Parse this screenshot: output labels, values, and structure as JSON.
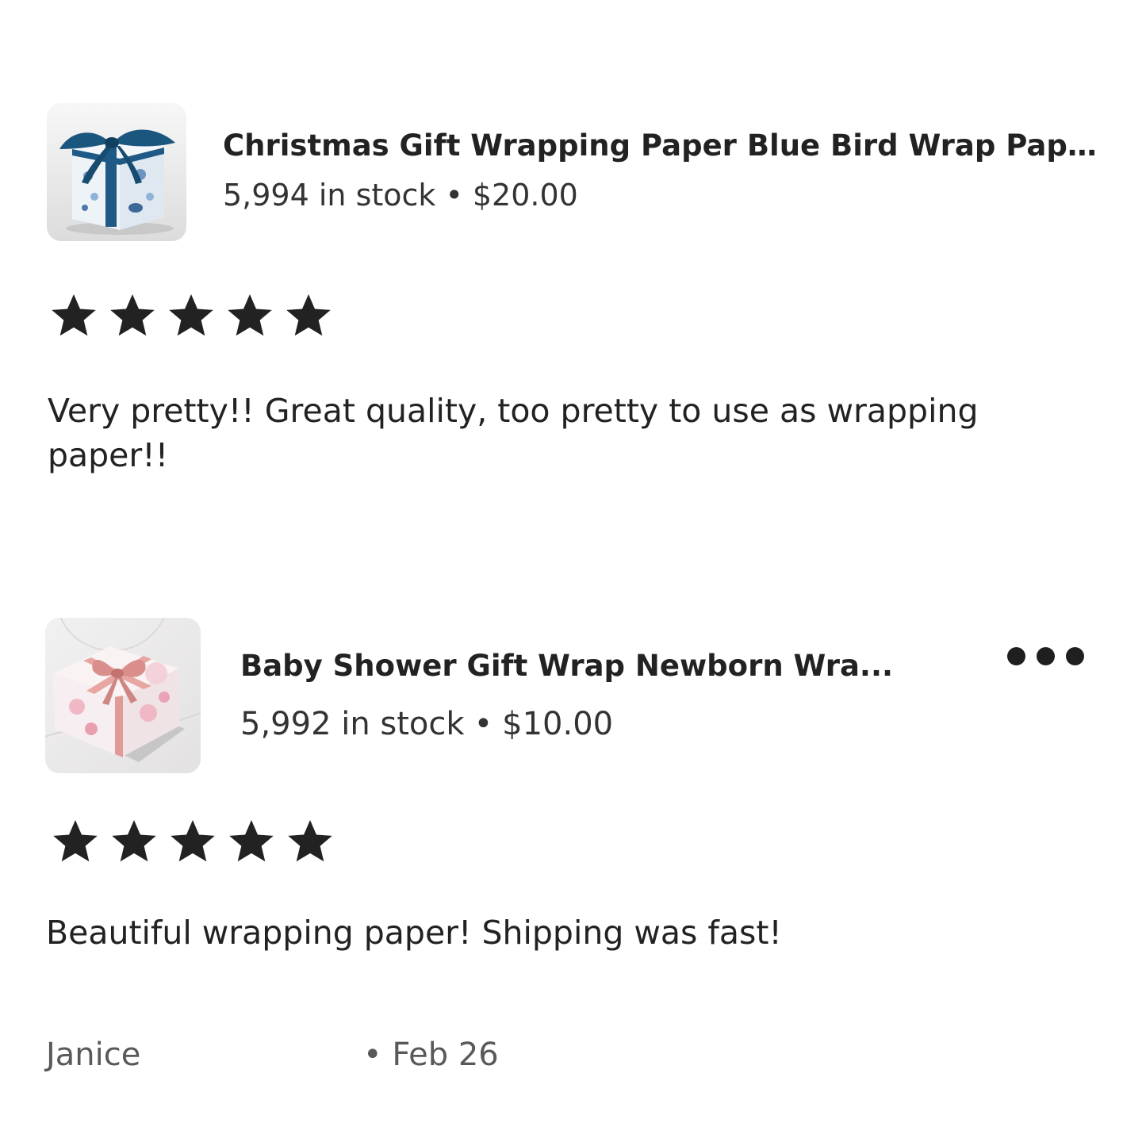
{
  "reviews": [
    {
      "product_title": "Christmas Gift Wrapping Paper Blue Bird Wrap Pape...",
      "stock": "5,994 in stock",
      "separator": "•",
      "price": "$20.00",
      "rating": 5,
      "max_rating": 5,
      "text": "Very pretty!! Great quality, too pretty to use as wrapping paper!!",
      "thumb_icon": "blue-bird-gift-box-image"
    },
    {
      "product_title": "Baby Shower Gift Wrap Newborn Wra...",
      "stock": "5,992 in stock",
      "separator": "•",
      "price": "$10.00",
      "rating": 5,
      "max_rating": 5,
      "text": "Beautiful wrapping paper! Shipping was fast!",
      "thumb_icon": "pink-floral-gift-box-image",
      "more_icon": "more-options-icon",
      "reviewer": "Janice",
      "date_separator": "•",
      "date": "Feb 26"
    }
  ],
  "colors": {
    "text": "#222222",
    "muted": "#595959",
    "star": "#222222"
  }
}
